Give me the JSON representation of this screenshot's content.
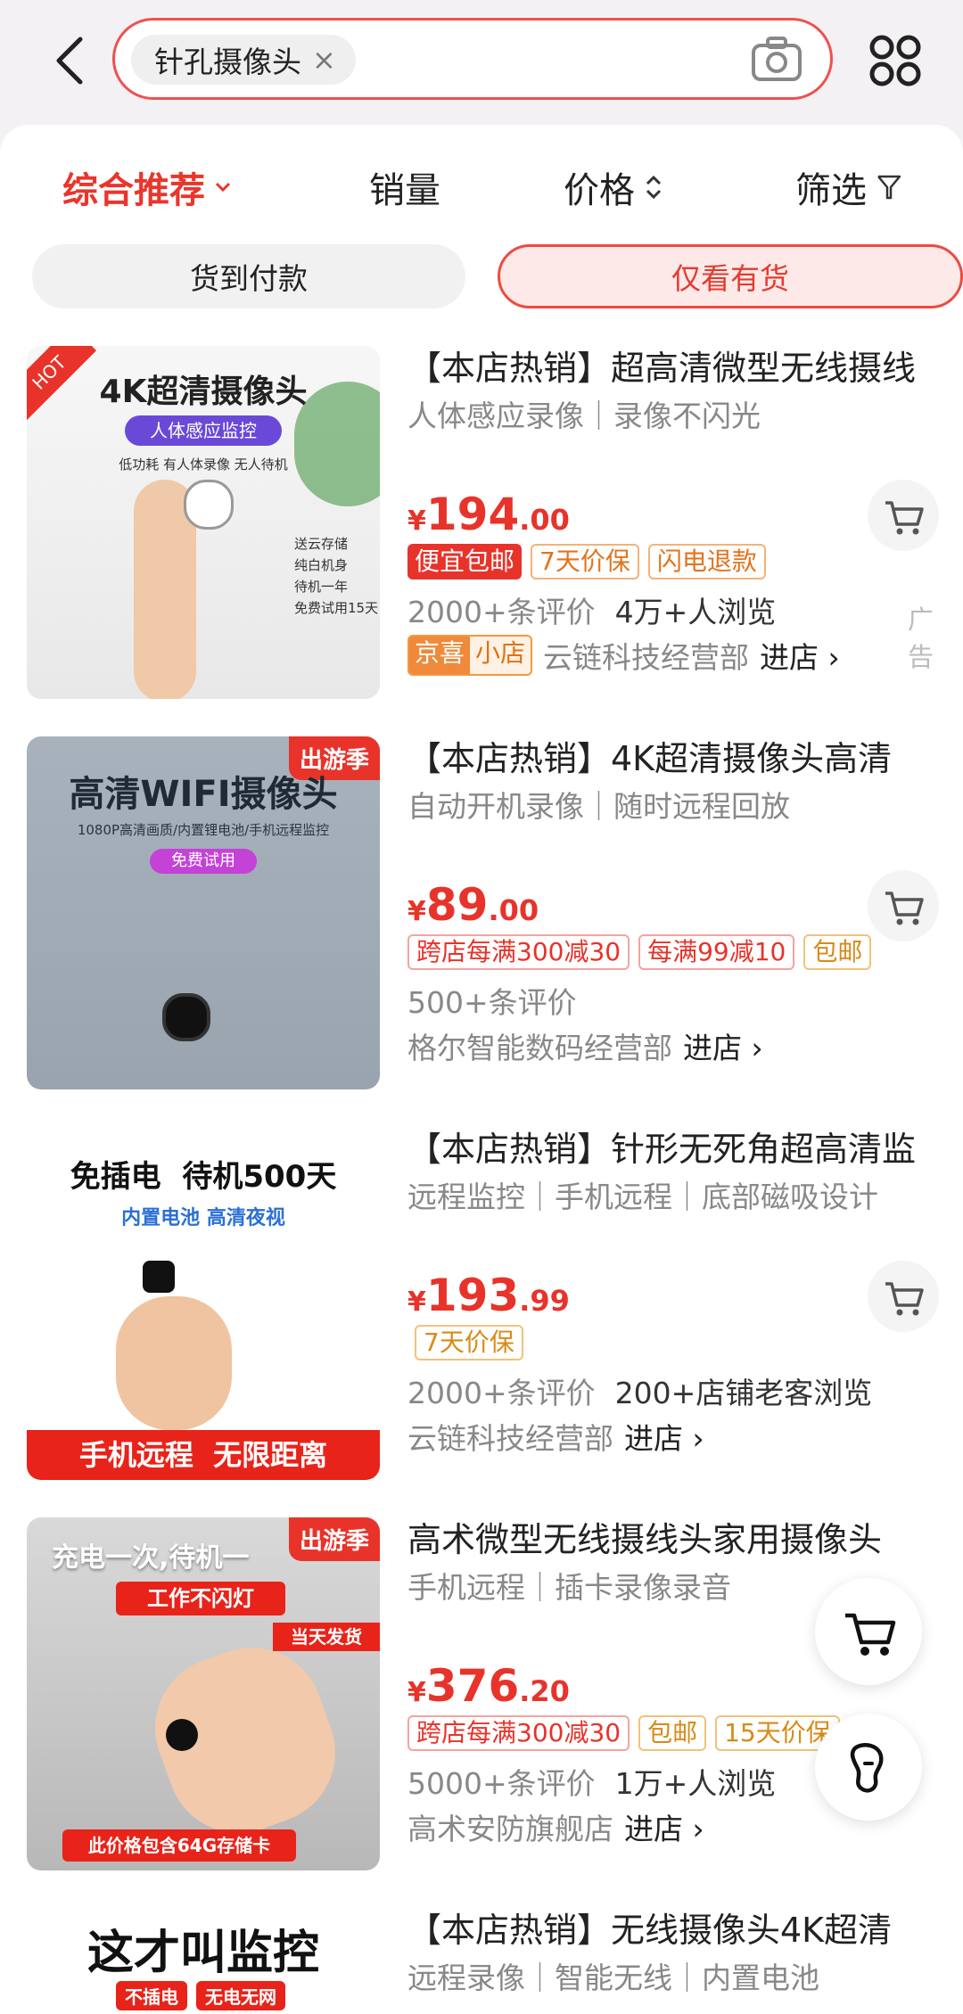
{
  "search": {
    "query": "针孔摄像头",
    "clear": "×"
  },
  "sort": {
    "comprehensive": "综合推荐",
    "sales": "销量",
    "price": "价格",
    "filter": "筛选"
  },
  "filters": {
    "cod": "货到付款",
    "in_stock": "仅看有货"
  },
  "products": [
    {
      "title": "【本店热销】超高清微型无线摄线",
      "subtitle": "人体感应录像｜录像不闪光",
      "price_int": "194",
      "price_dec": ".00",
      "currency": "¥",
      "tags": [
        "便宜包邮",
        "7天价保",
        "闪电退款"
      ],
      "stats": [
        "2000+条评价",
        "4万+人浏览"
      ],
      "shop_badge": [
        "京喜",
        "小店"
      ],
      "shop": "云链科技经营部",
      "enter": "进店 ›",
      "ad": "广告",
      "thumb": {
        "headline": "4K超清摄像头",
        "pill": "人体感应监控",
        "line": "低功耗 有人体录像 无人待机",
        "side": [
          "送云存储",
          "纯白机身",
          "待机一年",
          "免费试用15天"
        ],
        "hot": "HOT"
      }
    },
    {
      "title": "【本店热销】4K超清摄像头高清",
      "subtitle": "自动开机录像｜随时远程回放",
      "price_int": "89",
      "price_dec": ".00",
      "currency": "¥",
      "tags": [
        "跨店每满300减30",
        "每满99减10",
        "包邮"
      ],
      "stats": [
        "500+条评价"
      ],
      "shop": "格尔智能数码经营部",
      "enter": "进店 ›",
      "thumb": {
        "headline": "高清WIFI摄像头",
        "line": "1080P高清画质/内置锂电池/手机远程监控",
        "pill": "免费试用",
        "badge": "出游季"
      }
    },
    {
      "title": "【本店热销】针形无死角超高清监",
      "subtitle": "远程监控｜手机远程｜底部磁吸设计",
      "price_int": "193",
      "price_dec": ".99",
      "currency": "¥",
      "tags": [
        "7天价保"
      ],
      "stats": [
        "2000+条评价",
        "200+店铺老客浏览"
      ],
      "shop": "云链科技经营部",
      "enter": "进店 ›",
      "thumb": {
        "headline": "免插电  待机500天",
        "pill": "内置电池 高清夜视",
        "footer": "手机远程  无限距离"
      }
    },
    {
      "title": "高术微型无线摄线头家用摄像头",
      "subtitle": "手机远程｜插卡录像录音",
      "price_int": "376",
      "price_dec": ".20",
      "currency": "¥",
      "tags": [
        "跨店每满300减30",
        "包邮",
        "15天价保"
      ],
      "stats": [
        "5000+条评价",
        "1万+人浏览"
      ],
      "shop": "高术安防旗舰店",
      "enter": "进店 ›",
      "thumb": {
        "headline": "充电一次,待机一",
        "pill": "工作不闪灯",
        "ship": "当天发货",
        "footer": "此价格包含64G存储卡",
        "badge": "出游季"
      }
    },
    {
      "title": "【本店热销】无线摄像头4K超清",
      "subtitle": "远程录像｜智能无线｜内置电池",
      "thumb": {
        "headline": "这才叫监控",
        "chips": [
          "不插电",
          "无电无网"
        ]
      }
    }
  ],
  "icons": [
    "back-arrow-icon",
    "camera-icon",
    "grid-menu-icon",
    "chevron-down-icon",
    "sort-arrows-icon",
    "filter-funnel-icon",
    "cart-icon",
    "footprint-icon"
  ],
  "colors": {
    "accent": "#e8332a",
    "search_border": "#f14f50"
  }
}
